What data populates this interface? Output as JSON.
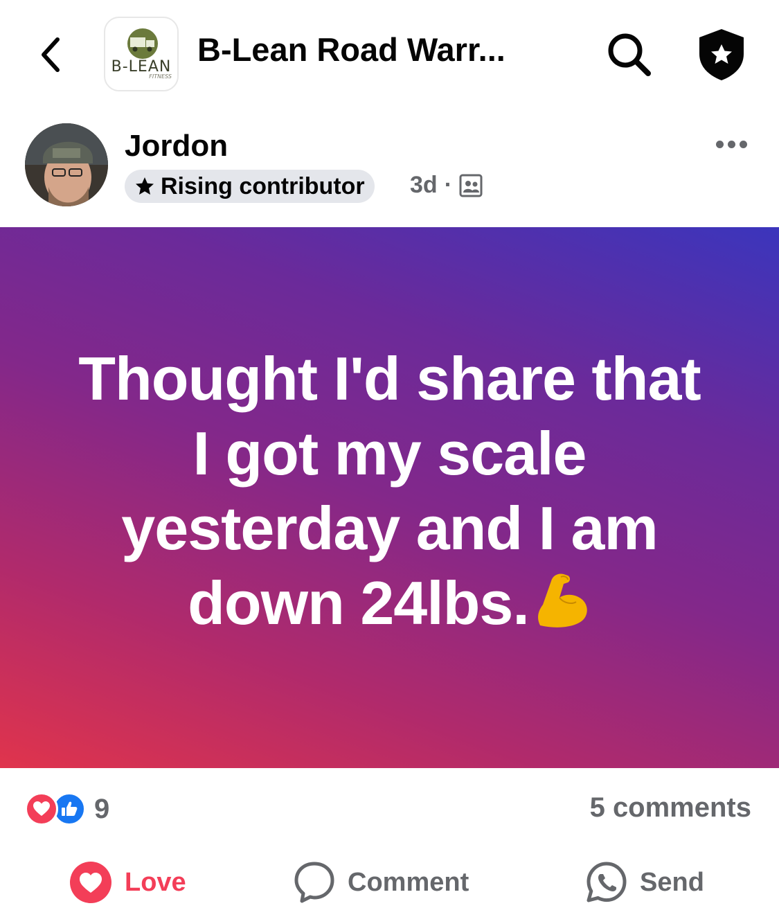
{
  "header": {
    "group_title": "B-Lean Road Warr...",
    "logo_text": "B-LEAN",
    "logo_sub": "FITNESS",
    "back_icon": "chevron-left-icon",
    "search_icon": "search-icon",
    "shield_icon": "shield-star-icon"
  },
  "post": {
    "author": "Jordon",
    "badge_label": "Rising contributor",
    "time": "3d",
    "separator": "·",
    "audience_icon": "group-members-icon",
    "text": "Thought I'd share that I got my scale yesterday and I am down 24lbs.",
    "emoji_icon": "flexed-biceps-icon",
    "background_colors": [
      "#e0344c",
      "#83288a",
      "#3b35bc"
    ]
  },
  "stats": {
    "reaction_count": "9",
    "comments": "5 comments",
    "reactions": [
      "love",
      "like"
    ]
  },
  "actions": {
    "love": "Love",
    "comment": "Comment",
    "send": "Send"
  },
  "colors": {
    "love": "#f33e58",
    "like": "#1877f2",
    "muted": "#65676b"
  }
}
